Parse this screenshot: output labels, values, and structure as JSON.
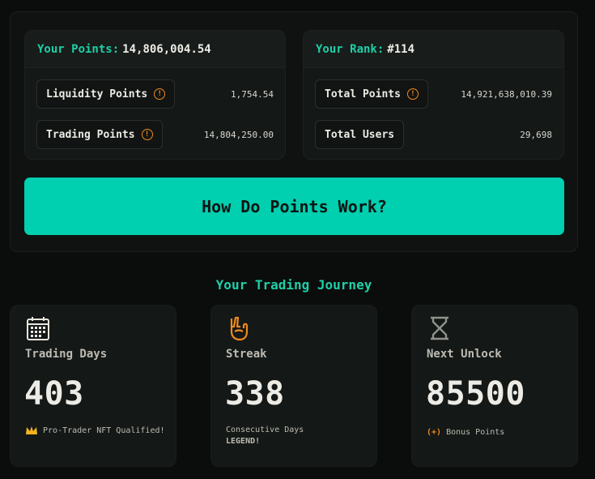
{
  "points_card": {
    "title_label": "Your Points:",
    "title_value": "14,806,004.54",
    "rows": [
      {
        "label": "Liquidity Points",
        "value": "1,754.54"
      },
      {
        "label": "Trading Points",
        "value": "14,804,250.00"
      }
    ]
  },
  "rank_card": {
    "title_label": "Your Rank:",
    "title_value": "#114",
    "rows": [
      {
        "label": "Total Points",
        "value": "14,921,638,010.39"
      },
      {
        "label": "Total Users",
        "value": "29,698"
      }
    ]
  },
  "cta": {
    "label": "How Do Points Work?"
  },
  "journey": {
    "title": "Your Trading Journey",
    "stats": [
      {
        "icon": "calendar-icon",
        "label": "Trading Days",
        "value": "403",
        "note": "Pro-Trader NFT Qualified!"
      },
      {
        "icon": "hand-icon",
        "label": "Streak",
        "value": "338",
        "note": "Consecutive Days",
        "tag": "LEGEND!"
      },
      {
        "icon": "hourglass-icon",
        "label": "Next Unlock",
        "value": "85500",
        "note_prefix": "(+)",
        "note": "Bonus Points"
      }
    ]
  },
  "colors": {
    "accent": "#00cfb0",
    "warning": "#f08a1c",
    "background": "#0b0d0c"
  }
}
